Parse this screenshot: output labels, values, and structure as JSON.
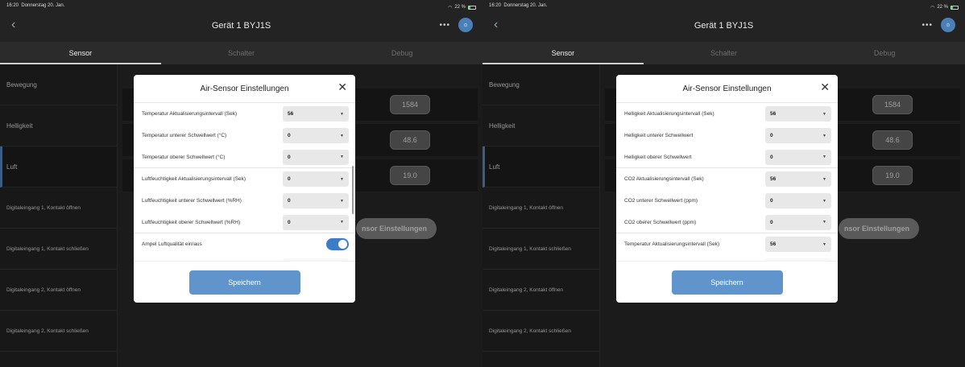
{
  "status": {
    "time": "16:20",
    "date": "Donnerstag 20. Jan.",
    "battery": "22 %"
  },
  "nav": {
    "back_icon": "chevron-left-icon",
    "title": "Gerät 1 BYJ1S",
    "more": "•••",
    "avatar": "⊙"
  },
  "tabs": [
    "Sensor",
    "Schalter",
    "Debug"
  ],
  "sidebar": [
    "Bewegung",
    "Helligkeit",
    "Luft",
    "Digitaleingang 1, Kontakt öffnen",
    "Digitaleingang 1, Kontakt schließen",
    "Digitaleingang 2, Kontakt öffnen",
    "Digitaleingang 2, Kontakt schließen"
  ],
  "background": {
    "values": [
      "1584",
      "48.6",
      "19.0"
    ],
    "button": "nsor Einstellungen"
  },
  "left_modal": {
    "title": "Air-Sensor Einstellungen",
    "rows": [
      {
        "label": "Temperatur Aktualisierungsintervall (Sek)",
        "value": "56"
      },
      {
        "label": "Temperatur unterer Schwellwert (°C)",
        "value": "0"
      },
      {
        "label": "Temperatur oberer Schwellwert (°C)",
        "value": "0"
      },
      {
        "label": "Luftfeuchtigkeit Aktualisierungsintervall (Sek)",
        "value": "0"
      },
      {
        "label": "Luftfeuchtigkeit unterer Schwellwert (%RH)",
        "value": "0"
      },
      {
        "label": "Luftfeuchtigkeit oberer Schwellwert (%RH)",
        "value": "0"
      }
    ],
    "toggle_label": "Ampel Luftqualität ein/aus",
    "toggle_state": "on",
    "save": "Speichern"
  },
  "right_modal": {
    "title": "Air-Sensor Einstellungen",
    "rows": [
      {
        "label": "Helligkeit Aktualisierungsintervall (Sek)",
        "value": "56"
      },
      {
        "label": "Helligkeit unterer Schwellwert",
        "value": "0"
      },
      {
        "label": "Helligkeit oberer Schwellwert",
        "value": "0"
      },
      {
        "label": "CO2 Aktualisierungsintervall (Sek)",
        "value": "56"
      },
      {
        "label": "CO2 unterer Schwellwert (ppm)",
        "value": "0"
      },
      {
        "label": "CO2 oberer Schwellwert (ppm)",
        "value": "0"
      },
      {
        "label": "Temperatur Aktualisierungsintervall (Sek)",
        "value": "56"
      }
    ],
    "save": "Speichern"
  },
  "colors": {
    "accent": "#5f95cc",
    "toggle": "#3d7cc9",
    "sidebar_active": "#5b8fcb"
  }
}
